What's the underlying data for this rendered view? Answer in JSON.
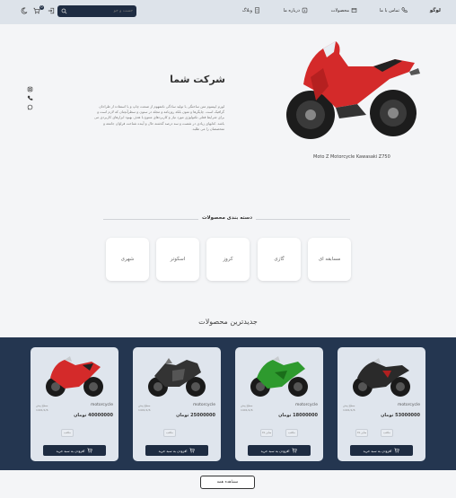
{
  "navbar": {
    "logo": "لوگو",
    "links": [
      {
        "label": "تماس با ما",
        "icon": "phone-icon"
      },
      {
        "label": "محصولات",
        "icon": "box-icon"
      },
      {
        "label": "درباره ما",
        "icon": "info-icon"
      },
      {
        "label": "وبلاگ",
        "icon": "doc-icon"
      }
    ],
    "search_placeholder": "جست و جو",
    "cart_count": "0"
  },
  "hero": {
    "title": "شرکت شما",
    "text": "لورم ایپسوم متن ساختگی با تولید سادگی نامفهوم از صنعت چاپ و با استفاده از طراحان گرافیک است. چاپگرها و متون بلکه روزنامه و مجله در ستون و سطرآنچنان که لازم است و برای شرایط فعلی تکنولوژی مورد نیاز و کاربردهای متنوع با هدف بهبود ابزارهای کاربردی می باشد. کتابهای زیادی در شصت و سه درصد گذشته حال و آینده شناخت فراوان جامعه و متخصصان را می طلبد.",
    "image_caption": "Moto Z Motorcycle Kawasaki Z750"
  },
  "categories": {
    "heading": "دسته بندی محصولات",
    "items": [
      "مسابقه ای",
      "گازی",
      "کروز",
      "اسکوتر",
      "شهری"
    ]
  },
  "products": {
    "heading": "جدیدترین محصولات",
    "add_to_cart": "افزودن به سبد خرید",
    "view_all": "مشاهده همه",
    "items": [
      {
        "name": "motorcycle",
        "price": "53000000 تومان",
        "tiny1": "سطح پیش",
        "tiny2": "1401/1/6",
        "sub1": "XL سایز",
        "sub2": "مکعب",
        "color": "#2a2a2a"
      },
      {
        "name": "motorcycle",
        "price": "18000000 تومان",
        "tiny1": "سطح پیش",
        "tiny2": "1401/1/6",
        "sub1": "XL سایز",
        "sub2": "مکعب",
        "color": "#2e9a2e"
      },
      {
        "name": "motorcycle",
        "price": "25000000 تومان",
        "tiny1": "سطح پیش",
        "tiny2": "1401/1/6",
        "sub1": "",
        "sub2": "مکعب",
        "color": "#333333"
      },
      {
        "name": "motorcycle",
        "price": "40000000 تومان",
        "tiny1": "سطح پیش",
        "tiny2": "1401/1/6",
        "sub1": "",
        "sub2": "مکعب",
        "color": "#d42a2a"
      }
    ]
  },
  "colors": {
    "dark": "#1e2c42",
    "band": "#243650",
    "bike_red": "#d42a2a"
  }
}
